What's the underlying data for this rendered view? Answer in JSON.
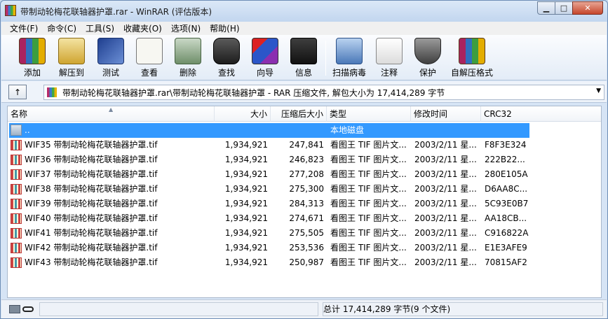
{
  "window": {
    "title": "带制动轮梅花联轴器护罩.rar - WinRAR (评估版本)",
    "minimize_glyph": "▁",
    "maximize_glyph": "□",
    "close_glyph": "✕"
  },
  "menu": [
    "文件(F)",
    "命令(C)",
    "工具(S)",
    "收藏夹(O)",
    "选项(N)",
    "帮助(H)"
  ],
  "toolbar": [
    {
      "label": "添加",
      "icon": "add-archive-icon"
    },
    {
      "label": "解压到",
      "icon": "extract-to-icon"
    },
    {
      "label": "测试",
      "icon": "test-icon"
    },
    {
      "label": "查看",
      "icon": "view-icon"
    },
    {
      "label": "删除",
      "icon": "delete-icon"
    },
    {
      "label": "查找",
      "icon": "find-icon"
    },
    {
      "label": "向导",
      "icon": "wizard-icon"
    },
    {
      "label": "信息",
      "icon": "info-icon"
    },
    {
      "label": "扫描病毒",
      "icon": "virus-scan-icon"
    },
    {
      "label": "注释",
      "icon": "comment-icon"
    },
    {
      "label": "保护",
      "icon": "protect-icon"
    },
    {
      "label": "自解压格式",
      "icon": "sfx-icon"
    }
  ],
  "path": {
    "up_glyph": "↑",
    "text": "带制动轮梅花联轴器护罩.rar\\带制动轮梅花联轴器护罩 - RAR 压缩文件, 解包大小为 17,414,289 字节",
    "dropdown_glyph": "▼"
  },
  "columns": {
    "name": "名称",
    "size": "大小",
    "packed": "压缩后大小",
    "type": "类型",
    "modified": "修改时间",
    "crc": "CRC32",
    "sort_glyph": "▲"
  },
  "parent_row": {
    "name": "..",
    "type": "本地磁盘"
  },
  "files": [
    {
      "name": "WIF35 带制动轮梅花联轴器护罩.tif",
      "size": "1,934,921",
      "packed": "247,841",
      "type": "看图王 TIF 图片文...",
      "modified": "2003/2/11 星...",
      "crc": "F8F3E324"
    },
    {
      "name": "WIF36 带制动轮梅花联轴器护罩.tif",
      "size": "1,934,921",
      "packed": "246,823",
      "type": "看图王 TIF 图片文...",
      "modified": "2003/2/11 星...",
      "crc": "222B22..."
    },
    {
      "name": "WIF37 带制动轮梅花联轴器护罩.tif",
      "size": "1,934,921",
      "packed": "277,208",
      "type": "看图王 TIF 图片文...",
      "modified": "2003/2/11 星...",
      "crc": "280E105A"
    },
    {
      "name": "WIF38 带制动轮梅花联轴器护罩.tif",
      "size": "1,934,921",
      "packed": "275,300",
      "type": "看图王 TIF 图片文...",
      "modified": "2003/2/11 星...",
      "crc": "D6AA8C..."
    },
    {
      "name": "WIF39 带制动轮梅花联轴器护罩.tif",
      "size": "1,934,921",
      "packed": "284,313",
      "type": "看图王 TIF 图片文...",
      "modified": "2003/2/11 星...",
      "crc": "5C93E0B7"
    },
    {
      "name": "WIF40 带制动轮梅花联轴器护罩.tif",
      "size": "1,934,921",
      "packed": "274,671",
      "type": "看图王 TIF 图片文...",
      "modified": "2003/2/11 星...",
      "crc": "AA18CB..."
    },
    {
      "name": "WIF41 带制动轮梅花联轴器护罩.tif",
      "size": "1,934,921",
      "packed": "275,505",
      "type": "看图王 TIF 图片文...",
      "modified": "2003/2/11 星...",
      "crc": "C916822A"
    },
    {
      "name": "WIF42 带制动轮梅花联轴器护罩.tif",
      "size": "1,934,921",
      "packed": "253,536",
      "type": "看图王 TIF 图片文...",
      "modified": "2003/2/11 星...",
      "crc": "E1E3AFE9"
    },
    {
      "name": "WIF43 带制动轮梅花联轴器护罩.tif",
      "size": "1,934,921",
      "packed": "250,987",
      "type": "看图王 TIF 图片文...",
      "modified": "2003/2/11 星...",
      "crc": "70815AF2"
    }
  ],
  "status": {
    "total": "总计 17,414,289 字节(9 个文件)"
  },
  "colors": {
    "selection": "#3399ff",
    "title_bar": "#c2d6ef"
  }
}
